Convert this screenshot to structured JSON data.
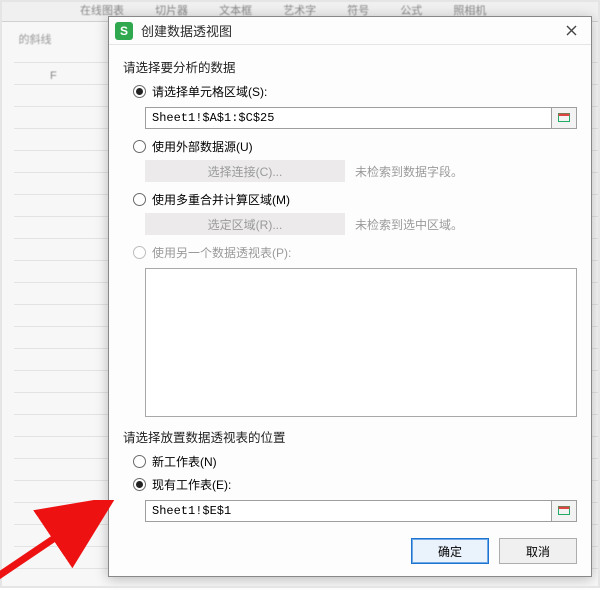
{
  "bg": {
    "ribbon_items": [
      "在线图表",
      "切片器",
      "文本框",
      "艺术字",
      "符号",
      "公式",
      "照相机"
    ],
    "left_text": "的斜线",
    "col_label": "F"
  },
  "dialog": {
    "app_glyph": "S",
    "title": "创建数据透视图",
    "section_data_label": "请选择要分析的数据",
    "opt_cell_range": "请选择单元格区域(S):",
    "range_value": "Sheet1!$A$1:$C$25",
    "opt_external": "使用外部数据源(U)",
    "btn_choose_conn": "选择连接(C)...",
    "note_no_field": "未检索到数据字段。",
    "opt_multi": "使用多重合并计算区域(M)",
    "btn_sel_region": "选定区域(R)...",
    "note_no_region": "未检索到选中区域。",
    "opt_another": "使用另一个数据透视表(P):",
    "section_location_label": "请选择放置数据透视表的位置",
    "opt_new_sheet": "新工作表(N)",
    "opt_existing": "现有工作表(E):",
    "location_value": "Sheet1!$E$1",
    "btn_ok": "确定",
    "btn_cancel": "取消"
  }
}
